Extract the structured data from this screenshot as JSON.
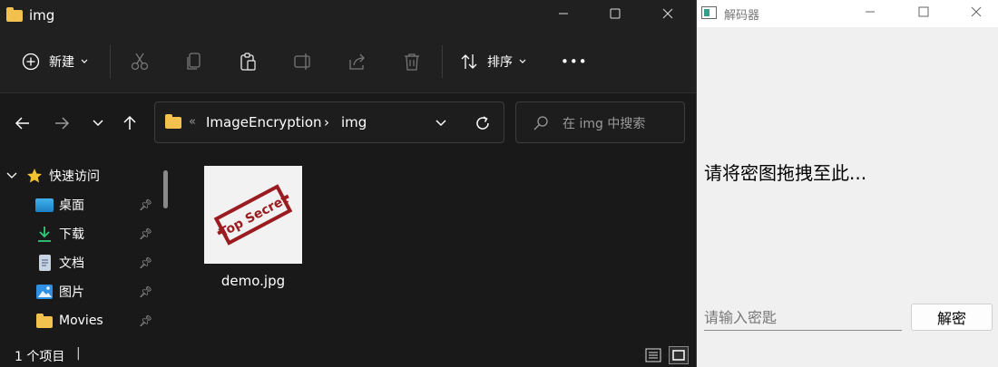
{
  "explorer": {
    "window_title": "img",
    "toolbar": {
      "new_label": "新建",
      "sort_label": "排序",
      "more_label": "•••"
    },
    "address": {
      "separator": "«",
      "crumbs": [
        "ImageEncryption",
        "img"
      ],
      "crumb_sep": "›"
    },
    "search": {
      "placeholder": "在 img 中搜索"
    },
    "nav": {
      "quick_access": "快速访问",
      "items": [
        {
          "label": "桌面",
          "icon": "desktop-icon"
        },
        {
          "label": "下载",
          "icon": "download-icon"
        },
        {
          "label": "文档",
          "icon": "document-icon"
        },
        {
          "label": "图片",
          "icon": "pictures-icon"
        },
        {
          "label": "Movies",
          "icon": "folder-icon"
        }
      ]
    },
    "files": [
      {
        "name": "demo.jpg",
        "stamp_text": "Top Secret"
      }
    ],
    "status": {
      "count_text": "1 个项目",
      "divider": "|"
    },
    "colors": {
      "background": "#191919",
      "chrome": "#202020",
      "folder": "#f2c14e",
      "stamp": "#9b1c20"
    }
  },
  "decoder": {
    "window_title": "解码器",
    "drop_label": "请将密图拖拽至此...",
    "password_placeholder": "请输入密匙",
    "decrypt_button": "解密",
    "colors": {
      "background": "#f0f0f0"
    }
  }
}
